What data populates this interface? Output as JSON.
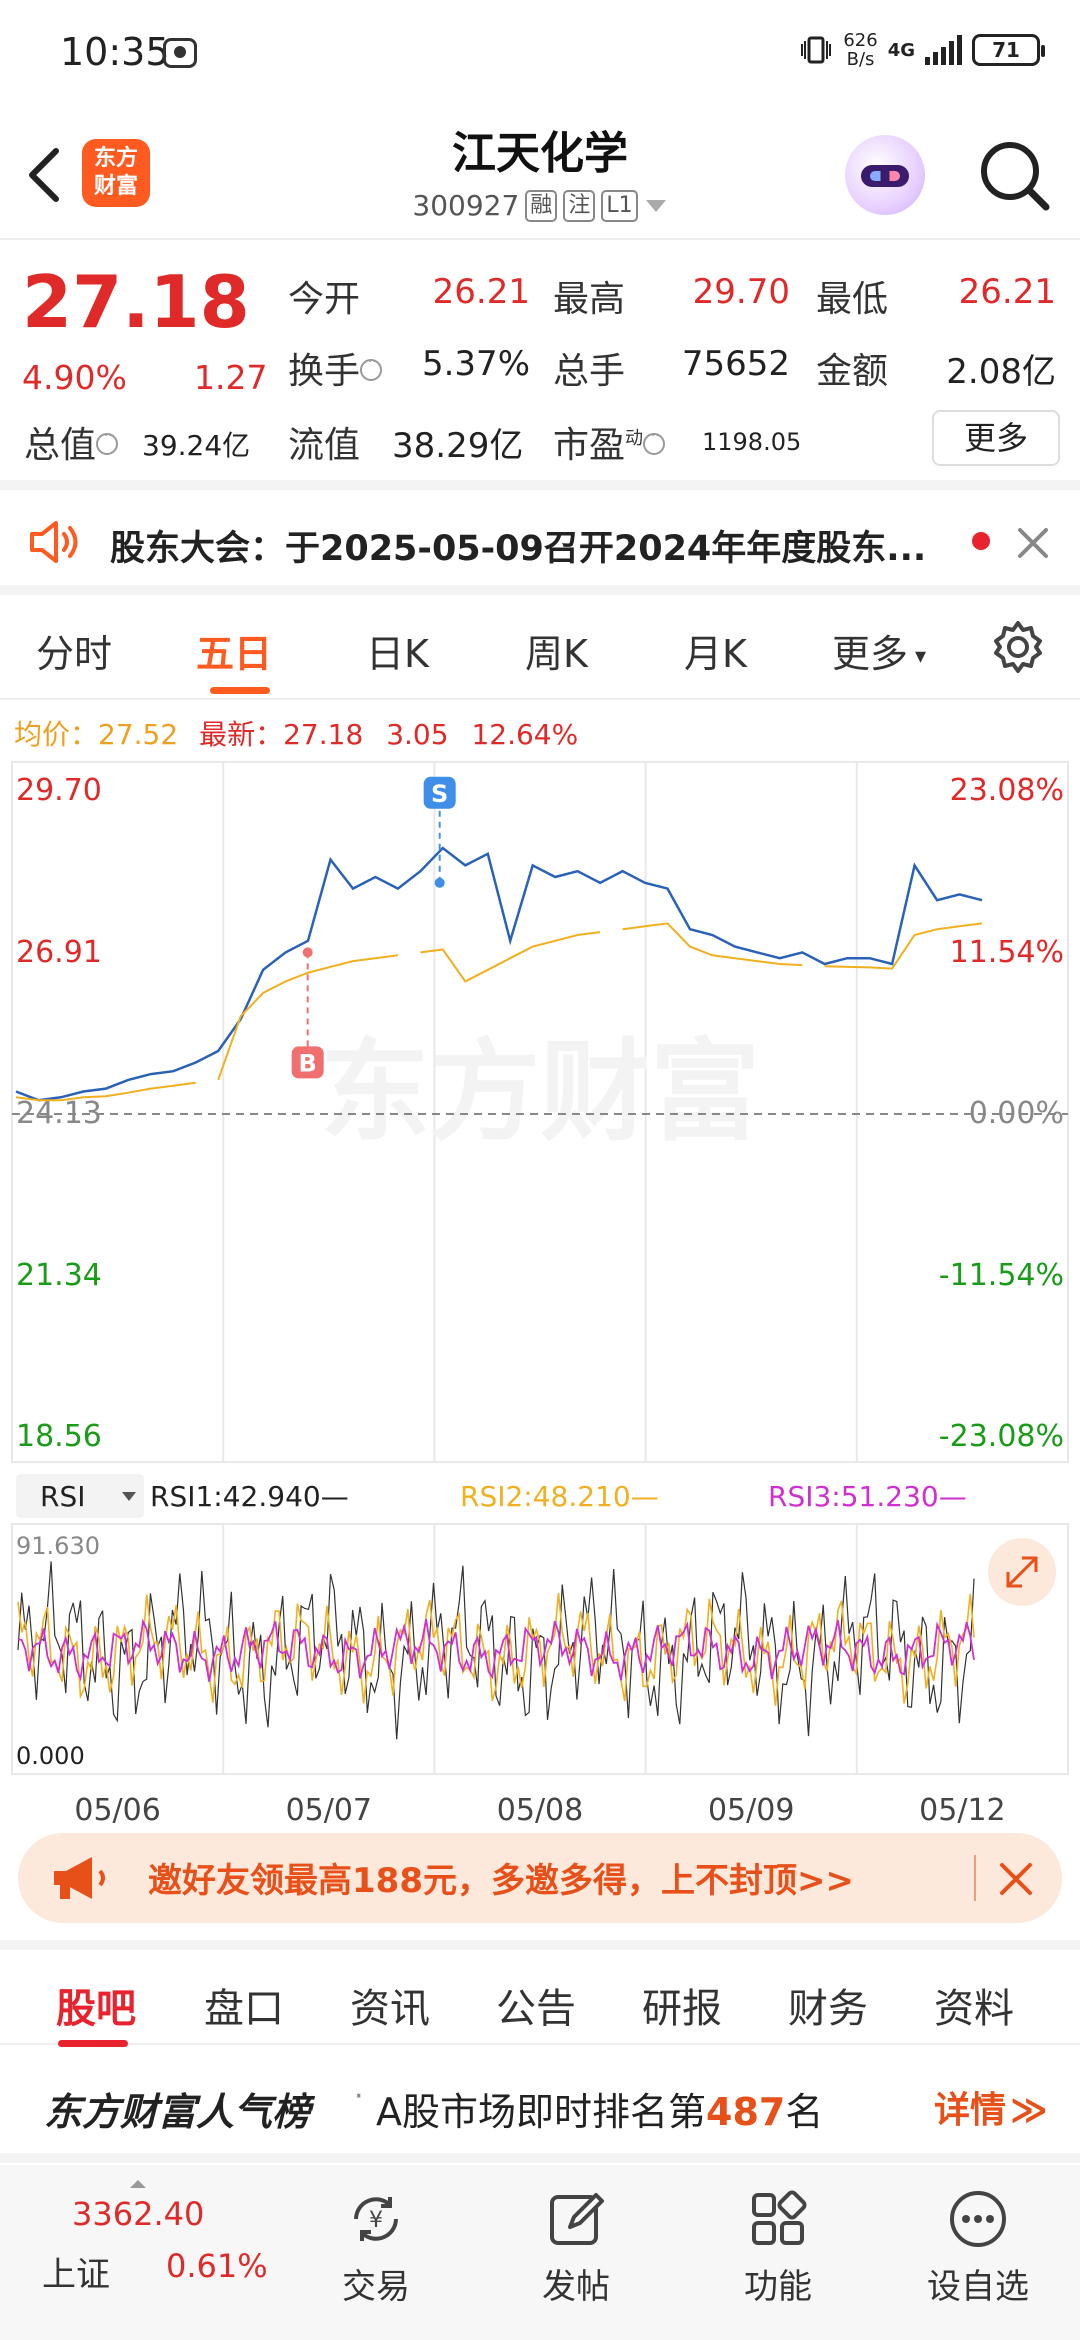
{
  "status_bar": {
    "time": "10:35",
    "net_speed_value": "626",
    "net_speed_unit": "B/s",
    "network": "4G",
    "battery": "71"
  },
  "header": {
    "logo_line1": "东方",
    "logo_line2": "财富",
    "title": "江天化学",
    "code": "300927",
    "tags": [
      "融",
      "注",
      "L1"
    ]
  },
  "quote": {
    "price": "27.18",
    "change_pct": "4.90%",
    "change": "1.27",
    "open_label": "今开",
    "open": "26.21",
    "high_label": "最高",
    "high": "29.70",
    "low_label": "最低",
    "low": "26.21",
    "turnover_label": "换手",
    "turnover": "5.37%",
    "volume_label": "总手",
    "volume": "75652",
    "amount_label": "金额",
    "amount": "2.08亿",
    "mktcap_label": "总值",
    "mktcap": "39.24亿",
    "float_label": "流值",
    "float": "38.29亿",
    "pe_label": "市盈",
    "pe_sup": "动",
    "pe": "1198.05",
    "more": "更多"
  },
  "notice": {
    "text": "股东大会：于2025-05-09召开2024年年度股东..."
  },
  "tabs": [
    "分时",
    "五日",
    "日K",
    "周K",
    "月K",
    "更多"
  ],
  "info_line": {
    "avg_label": "均价：",
    "avg": "27.52",
    "latest_label": "最新：",
    "latest": "27.18",
    "chg": "3.05",
    "chg_pct": "12.64%"
  },
  "chart_data": {
    "type": "line",
    "title": "",
    "x_ticks": [
      "05/06",
      "05/07",
      "05/08",
      "05/09",
      "05/12"
    ],
    "y_left": [
      "29.70",
      "26.91",
      "24.13",
      "21.34",
      "18.56"
    ],
    "y_right": [
      "23.08%",
      "11.54%",
      "0.00%",
      "-11.54%",
      "-23.08%"
    ],
    "ylim": [
      18.56,
      29.7
    ],
    "prev_close": 24.13,
    "series": [
      {
        "color": "#2a62b8",
        "values": [
          24.5,
          24.35,
          24.4,
          24.5,
          24.55,
          24.7,
          24.8,
          24.85,
          25.0,
          25.2,
          25.75,
          26.6,
          26.9,
          27.1,
          28.5,
          28.0,
          28.2,
          28.0,
          28.3,
          28.7,
          28.4,
          28.6,
          27.1,
          28.4,
          28.2,
          28.3,
          28.1,
          28.3,
          28.1,
          28.0,
          27.3,
          27.2,
          27.0,
          26.9,
          26.8,
          26.9,
          26.7,
          26.8,
          26.8,
          26.7,
          28.4,
          27.8,
          27.9,
          27.8
        ]
      },
      {
        "color": "#f0b020",
        "values": [
          24.4,
          24.35,
          24.35,
          24.4,
          24.42,
          24.48,
          24.55,
          24.6,
          24.65,
          24.7,
          25.8,
          26.2,
          26.4,
          26.55,
          26.65,
          26.75,
          26.8,
          26.85,
          26.9,
          26.95,
          26.4,
          26.6,
          26.8,
          27.0,
          27.1,
          27.2,
          27.25,
          27.3,
          27.35,
          27.4,
          27.0,
          26.85,
          26.8,
          26.75,
          26.7,
          26.68,
          26.66,
          26.65,
          26.64,
          26.62,
          27.2,
          27.3,
          27.35,
          27.4
        ]
      }
    ],
    "markers": [
      {
        "label": "B",
        "value": 26.9
      },
      {
        "label": "S",
        "value": 28.1
      }
    ],
    "rsi": {
      "selector": "RSI",
      "rsi1": "RSI1:42.940—",
      "rsi2": "RSI2:48.210—",
      "rsi3": "RSI3:51.230—",
      "top": "91.630",
      "bottom": "0.000"
    },
    "watermark": "东方财富"
  },
  "ad": {
    "text": "邀好友领最高188元，多邀多得，上不封顶>>"
  },
  "gu_tabs": [
    "股吧",
    "盘口",
    "资讯",
    "公告",
    "研报",
    "财务",
    "资料"
  ],
  "popularity": {
    "title": "东方财富人气榜",
    "text_before": "A股市场即时排名第",
    "rank": "487",
    "text_after": "名",
    "link": "详情"
  },
  "bottom_nav": {
    "index_value": "3362.40",
    "index_name": "上证",
    "index_pct": "0.61%",
    "trade": "交易",
    "post": "发帖",
    "func": "功能",
    "watch": "设自选"
  },
  "colors": {
    "up": "#e02a2a",
    "down": "#1a9c1a",
    "accent": "#ff5a1f",
    "price_line": "#2a62b8",
    "avg_line": "#f0b020"
  }
}
